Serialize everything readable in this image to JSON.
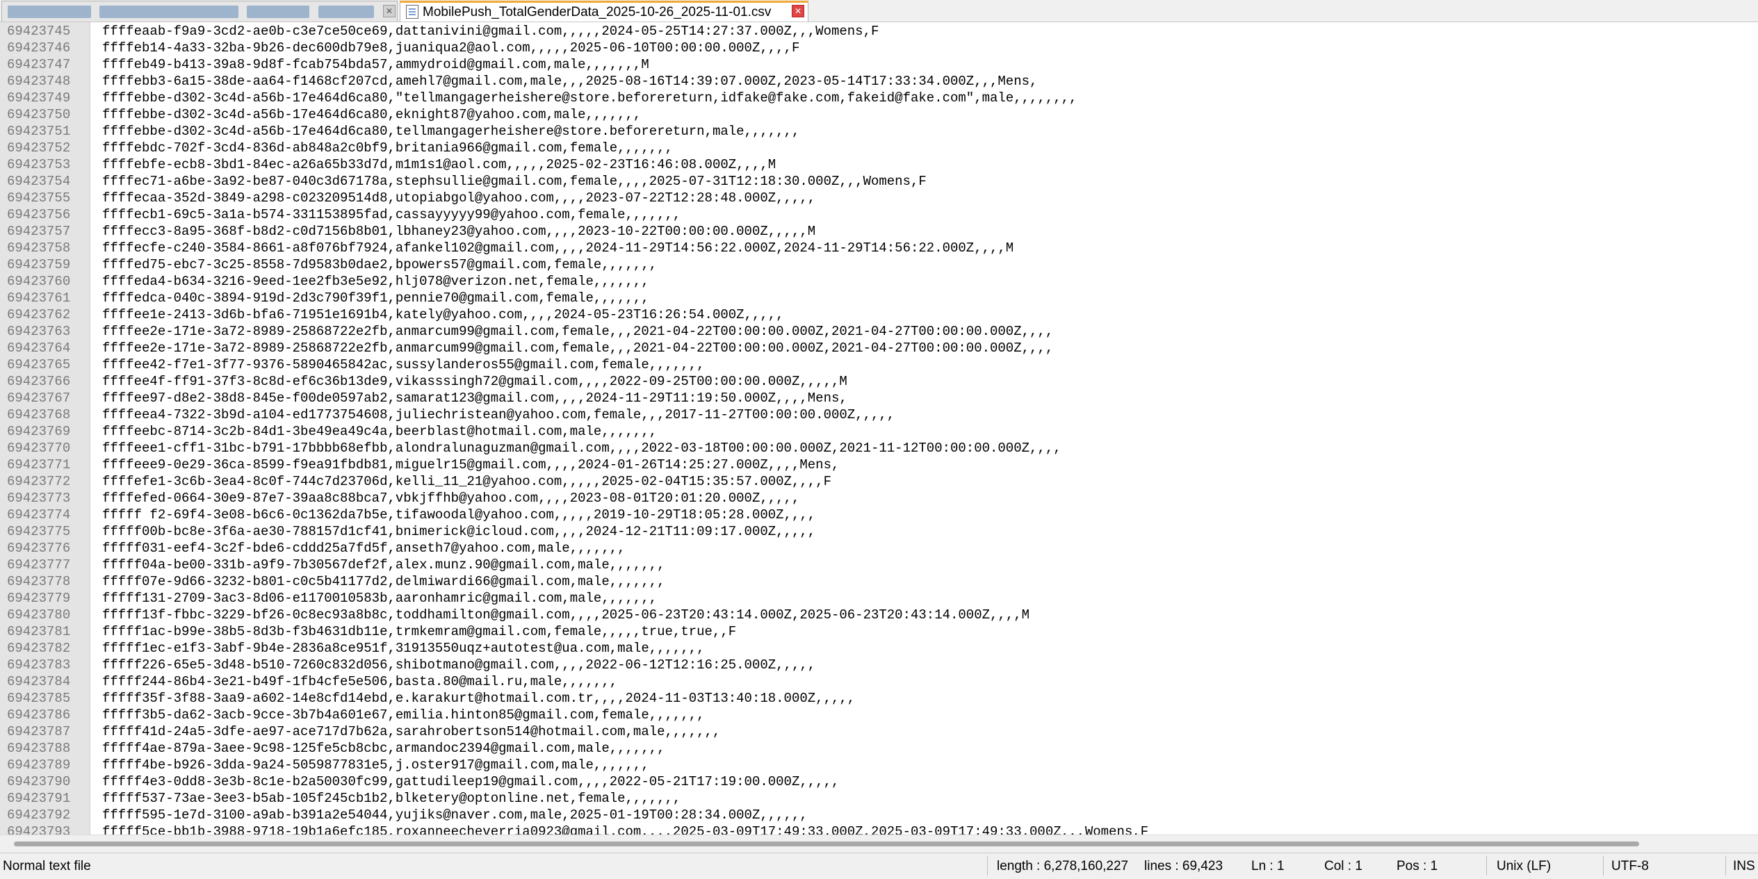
{
  "tabs": [
    {
      "label": "",
      "active": false,
      "blurred": true
    },
    {
      "label": "MobilePush_TotalGenderData_2025-10-26_2025-11-01.csv",
      "active": true
    }
  ],
  "editor": {
    "lines": [
      {
        "n": "69423745",
        "t": "ffffeaab-f9a9-3cd2-ae0b-c3e7ce50ce69,dattanivini@gmail.com,,,,,2024-05-25T14:27:37.000Z,,,Womens,F"
      },
      {
        "n": "69423746",
        "t": "ffffeb14-4a33-32ba-9b26-dec600db79e8,juaniqua2@aol.com,,,,,2025-06-10T00:00:00.000Z,,,,F"
      },
      {
        "n": "69423747",
        "t": "ffffeb49-b413-39a8-9d8f-fcab754bda57,ammydroid@gmail.com,male,,,,,,,M"
      },
      {
        "n": "69423748",
        "t": "ffffebb3-6a15-38de-aa64-f1468cf207cd,amehl7@gmail.com,male,,,2025-08-16T14:39:07.000Z,2023-05-14T17:33:34.000Z,,,Mens,"
      },
      {
        "n": "69423749",
        "t": "ffffebbe-d302-3c4d-a56b-17e464d6ca80,\"tellmangagerheishere@store.beforereturn,idfake@fake.com,fakeid@fake.com\",male,,,,,,,,"
      },
      {
        "n": "69423750",
        "t": "ffffebbe-d302-3c4d-a56b-17e464d6ca80,eknight87@yahoo.com,male,,,,,,,"
      },
      {
        "n": "69423751",
        "t": "ffffebbe-d302-3c4d-a56b-17e464d6ca80,tellmangagerheishere@store.beforereturn,male,,,,,,,"
      },
      {
        "n": "69423752",
        "t": "ffffebdc-702f-3cd4-836d-ab848a2c0bf9,britania966@gmail.com,female,,,,,,,"
      },
      {
        "n": "69423753",
        "t": "ffffebfe-ecb8-3bd1-84ec-a26a65b33d7d,m1m1s1@aol.com,,,,,2025-02-23T16:46:08.000Z,,,,M"
      },
      {
        "n": "69423754",
        "t": "ffffec71-a6be-3a92-be87-040c3d67178a,stephsullie@gmail.com,female,,,,2025-07-31T12:18:30.000Z,,,Womens,F"
      },
      {
        "n": "69423755",
        "t": "ffffecaa-352d-3849-a298-c023209514d8,utopiabgol@yahoo.com,,,,2023-07-22T12:28:48.000Z,,,,,"
      },
      {
        "n": "69423756",
        "t": "ffffecb1-69c5-3a1a-b574-331153895fad,cassayyyyy99@yahoo.com,female,,,,,,,"
      },
      {
        "n": "69423757",
        "t": "ffffecc3-8a95-368f-b8d2-c0d7156b8b01,lbhaney23@yahoo.com,,,,2023-10-22T00:00:00.000Z,,,,,M"
      },
      {
        "n": "69423758",
        "t": "ffffecfe-c240-3584-8661-a8f076bf7924,afankel102@gmail.com,,,,2024-11-29T14:56:22.000Z,2024-11-29T14:56:22.000Z,,,,M"
      },
      {
        "n": "69423759",
        "t": "ffffed75-ebc7-3c25-8558-7d9583b0dae2,bpowers57@gmail.com,female,,,,,,,"
      },
      {
        "n": "69423760",
        "t": "ffffeda4-b634-3216-9eed-1ee2fb3e5e92,hlj078@verizon.net,female,,,,,,,"
      },
      {
        "n": "69423761",
        "t": "ffffedca-040c-3894-919d-2d3c790f39f1,pennie70@gmail.com,female,,,,,,,"
      },
      {
        "n": "69423762",
        "t": "ffffee1e-2413-3d6b-bfa6-71951e1691b4,kately@yahoo.com,,,,2024-05-23T16:26:54.000Z,,,,,"
      },
      {
        "n": "69423763",
        "t": "ffffee2e-171e-3a72-8989-25868722e2fb,anmarcum99@gmail.com,female,,,2021-04-22T00:00:00.000Z,2021-04-27T00:00:00.000Z,,,,"
      },
      {
        "n": "69423764",
        "t": "ffffee2e-171e-3a72-8989-25868722e2fb,anmarcum99@gmail.com,female,,,2021-04-22T00:00:00.000Z,2021-04-27T00:00:00.000Z,,,,"
      },
      {
        "n": "69423765",
        "t": "ffffee42-f7e1-3f77-9376-5890465842ac,sussylanderos55@gmail.com,female,,,,,,,"
      },
      {
        "n": "69423766",
        "t": "ffffee4f-ff91-37f3-8c8d-ef6c36b13de9,vikasssingh72@gmail.com,,,,2022-09-25T00:00:00.000Z,,,,,M"
      },
      {
        "n": "69423767",
        "t": "ffffee97-d8e2-38d8-845e-f00de0597ab2,samarat123@gmail.com,,,,2024-11-29T11:19:50.000Z,,,,Mens,"
      },
      {
        "n": "69423768",
        "t": "ffffeea4-7322-3b9d-a104-ed1773754608,juliechristean@yahoo.com,female,,,2017-11-27T00:00:00.000Z,,,,,"
      },
      {
        "n": "69423769",
        "t": "ffffeebc-8714-3c2b-84d1-3be49ea49c4a,beerblast@hotmail.com,male,,,,,,,"
      },
      {
        "n": "69423770",
        "t": "ffffeee1-cff1-31bc-b791-17bbbb68efbb,alondralunaguzman@gmail.com,,,,2022-03-18T00:00:00.000Z,2021-11-12T00:00:00.000Z,,,,"
      },
      {
        "n": "69423771",
        "t": "ffffeee9-0e29-36ca-8599-f9ea91fbdb81,miguelr15@gmail.com,,,,2024-01-26T14:25:27.000Z,,,,Mens,"
      },
      {
        "n": "69423772",
        "t": "ffffefe1-3c6b-3ea4-8c0f-744c7d23706d,kelli_11_21@yahoo.com,,,,,2025-02-04T15:35:57.000Z,,,,F"
      },
      {
        "n": "69423773",
        "t": "ffffefed-0664-30e9-87e7-39aa8c88bca7,vbkjffhb@yahoo.com,,,,2023-08-01T20:01:20.000Z,,,,,"
      },
      {
        "n": "69423774",
        "t": "fffff f2-69f4-3e08-b6c6-0c1362da7b5e,tifawoodal@yahoo.com,,,,,2019-10-29T18:05:28.000Z,,,,"
      },
      {
        "n": "69423775",
        "t": "fffff00b-bc8e-3f6a-ae30-788157d1cf41,bnimerick@icloud.com,,,,2024-12-21T11:09:17.000Z,,,,,"
      },
      {
        "n": "69423776",
        "t": "fffff031-eef4-3c2f-bde6-cddd25a7fd5f,anseth7@yahoo.com,male,,,,,,,"
      },
      {
        "n": "69423777",
        "t": "fffff04a-be00-331b-a9f9-7b30567def2f,alex.munz.90@gmail.com,male,,,,,,,"
      },
      {
        "n": "69423778",
        "t": "fffff07e-9d66-3232-b801-c0c5b41177d2,delmiwardi66@gmail.com,male,,,,,,,"
      },
      {
        "n": "69423779",
        "t": "fffff131-2709-3ac3-8d06-e1170010583b,aaronhamric@gmail.com,male,,,,,,,"
      },
      {
        "n": "69423780",
        "t": "fffff13f-fbbc-3229-bf26-0c8ec93a8b8c,toddhamilton@gmail.com,,,,2025-06-23T20:43:14.000Z,2025-06-23T20:43:14.000Z,,,,M"
      },
      {
        "n": "69423781",
        "t": "fffff1ac-b99e-38b5-8d3b-f3b4631db11e,trmkemram@gmail.com,female,,,,,true,true,,F"
      },
      {
        "n": "69423782",
        "t": "fffff1ec-e1f3-3abf-9b4e-2836a8ce951f,31913550uqz+autotest@ua.com,male,,,,,,,"
      },
      {
        "n": "69423783",
        "t": "fffff226-65e5-3d48-b510-7260c832d056,shibotmano@gmail.com,,,,2022-06-12T12:16:25.000Z,,,,,"
      },
      {
        "n": "69423784",
        "t": "fffff244-86b4-3e21-b49f-1fb4cfe5e506,basta.80@mail.ru,male,,,,,,,"
      },
      {
        "n": "69423785",
        "t": "fffff35f-3f88-3aa9-a602-14e8cfd14ebd,e.karakurt@hotmail.com.tr,,,,2024-11-03T13:40:18.000Z,,,,,"
      },
      {
        "n": "69423786",
        "t": "fffff3b5-da62-3acb-9cce-3b7b4a601e67,emilia.hinton85@gmail.com,female,,,,,,,"
      },
      {
        "n": "69423787",
        "t": "fffff41d-24a5-3dfe-ae97-ace717d7b62a,sarahrobertson514@hotmail.com,male,,,,,,,"
      },
      {
        "n": "69423788",
        "t": "fffff4ae-879a-3aee-9c98-125fe5cb8cbc,armandoc2394@gmail.com,male,,,,,,,"
      },
      {
        "n": "69423789",
        "t": "fffff4be-b926-3dda-9a24-5059877831e5,j.oster917@gmail.com,male,,,,,,,"
      },
      {
        "n": "69423790",
        "t": "fffff4e3-0dd8-3e3b-8c1e-b2a50030fc99,gattudileep19@gmail.com,,,,2022-05-21T17:19:00.000Z,,,,,"
      },
      {
        "n": "69423791",
        "t": "fffff537-73ae-3ee3-b5ab-105f245cb1b2,blketery@optonline.net,female,,,,,,,"
      },
      {
        "n": "69423792",
        "t": "fffff595-1e7d-3100-a9ab-b391a2e54044,yujiks@naver.com,male,2025-01-19T00:28:34.000Z,,,,,,"
      },
      {
        "n": "69423793",
        "t": "fffff5ce-bb1b-3988-9718-19b1a6efc185,roxanneecheverria0923@gmail.com,,,,2025-03-09T17:49:33.000Z,2025-03-09T17:49:33.000Z,,,Womens,F"
      }
    ]
  },
  "status": {
    "type": "Normal text file",
    "length": "length : 6,278,160,227",
    "lines": "lines : 69,423",
    "ln": "Ln : 1",
    "col": "Col : 1",
    "pos": "Pos : 1",
    "eol": "Unix (LF)",
    "encoding": "UTF-8",
    "mode": "INS"
  },
  "icons": {
    "tab_file": "document-icon",
    "tab_close": "close-icon"
  }
}
